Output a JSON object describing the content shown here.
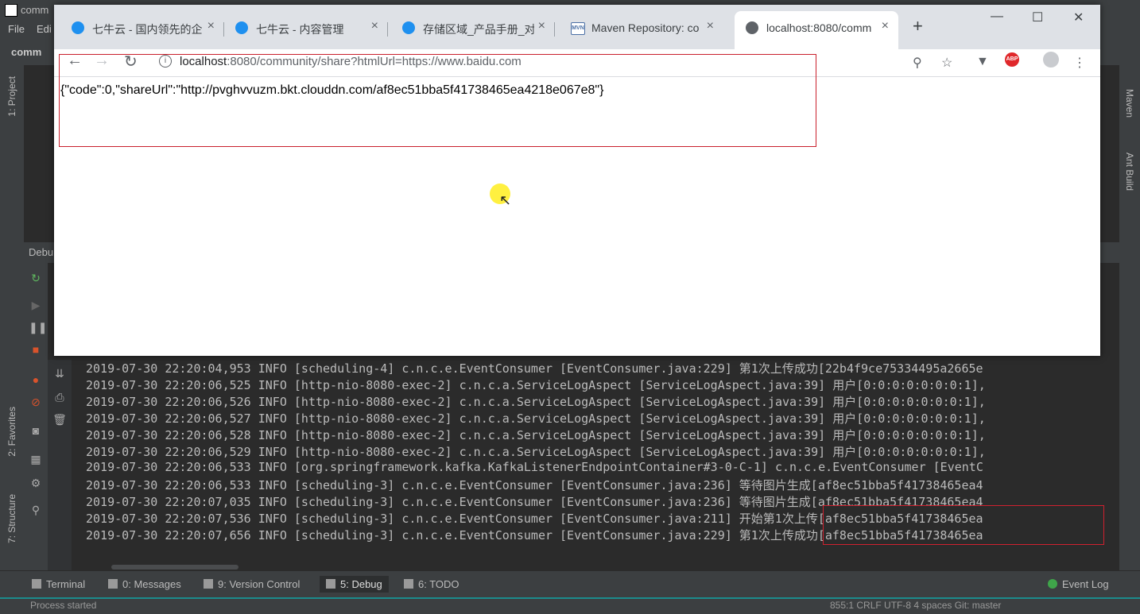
{
  "ide": {
    "title": "comm",
    "menu": [
      "File",
      "Edi"
    ],
    "breadcrumb": "comm",
    "left_tabs": [
      "1: Project",
      "2: Favorites",
      "7: Structure"
    ],
    "right_tabs": [
      "Maven",
      "Ant Build"
    ],
    "debug_label": "Debu"
  },
  "browser": {
    "tabs": [
      {
        "label": "七牛云 - 国内领先的企",
        "icon": "qiniu-icon"
      },
      {
        "label": "七牛云 - 内容管理",
        "icon": "qiniu-icon"
      },
      {
        "label": "存储区域_产品手册_对",
        "icon": "qiniu-icon"
      },
      {
        "label": "Maven Repository: co",
        "icon": "maven-icon"
      },
      {
        "label": "localhost:8080/comm",
        "icon": "globe-icon"
      }
    ],
    "new_tab": "+",
    "url_host": "localhost",
    "url_rest": ":8080/community/share?htmlUrl=https://www.baidu.com",
    "abp_label": "ABP",
    "response_text": "{\"code\":0,\"shareUrl\":\"http://pvghvvuzm.bkt.clouddn.com/af8ec51bba5f41738465ea4218e067e8\"}"
  },
  "console": {
    "lines": [
      "2019-07-30 22:20:04,953 INFO [scheduling-4] c.n.c.e.EventConsumer [EventConsumer.java:229] 第1次上传成功[22b4f9ce75334495a2665e",
      "2019-07-30 22:20:06,525 INFO [http-nio-8080-exec-2] c.n.c.a.ServiceLogAspect [ServiceLogAspect.java:39] 用户[0:0:0:0:0:0:0:1],",
      "2019-07-30 22:20:06,526 INFO [http-nio-8080-exec-2] c.n.c.a.ServiceLogAspect [ServiceLogAspect.java:39] 用户[0:0:0:0:0:0:0:1],",
      "2019-07-30 22:20:06,527 INFO [http-nio-8080-exec-2] c.n.c.a.ServiceLogAspect [ServiceLogAspect.java:39] 用户[0:0:0:0:0:0:0:1],",
      "2019-07-30 22:20:06,528 INFO [http-nio-8080-exec-2] c.n.c.a.ServiceLogAspect [ServiceLogAspect.java:39] 用户[0:0:0:0:0:0:0:1],",
      "2019-07-30 22:20:06,529 INFO [http-nio-8080-exec-2] c.n.c.a.ServiceLogAspect [ServiceLogAspect.java:39] 用户[0:0:0:0:0:0:0:1],",
      "2019-07-30 22:20:06,533 INFO [org.springframework.kafka.KafkaListenerEndpointContainer#3-0-C-1] c.n.c.e.EventConsumer [EventC",
      "2019-07-30 22:20:06,533 INFO [scheduling-3] c.n.c.e.EventConsumer [EventConsumer.java:236] 等待图片生成[af8ec51bba5f41738465ea4",
      "2019-07-30 22:20:07,035 INFO [scheduling-3] c.n.c.e.EventConsumer [EventConsumer.java:236] 等待图片生成[af8ec51bba5f41738465ea4",
      "2019-07-30 22:20:07,536 INFO [scheduling-3] c.n.c.e.EventConsumer [EventConsumer.java:211] 开始第1次上传[af8ec51bba5f41738465ea",
      "2019-07-30 22:20:07,656 INFO [scheduling-3] c.n.c.e.EventConsumer [EventConsumer.java:229] 第1次上传成功[af8ec51bba5f41738465ea"
    ]
  },
  "bottom_tabs": [
    {
      "label": "Terminal"
    },
    {
      "label": "0: Messages"
    },
    {
      "label": "9: Version Control"
    },
    {
      "label": "5: Debug"
    },
    {
      "label": "6: TODO"
    }
  ],
  "event_log": "Event Log",
  "status": {
    "left": "Process started",
    "right": "855:1   CRLF   UTF-8   4 spaces   Git: master"
  },
  "colors": {
    "ide_bg": "#2b2b2b",
    "ide_panel": "#3c3f41",
    "highlight_box": "#d0212f",
    "chrome_tabstrip": "#dee1e6"
  }
}
